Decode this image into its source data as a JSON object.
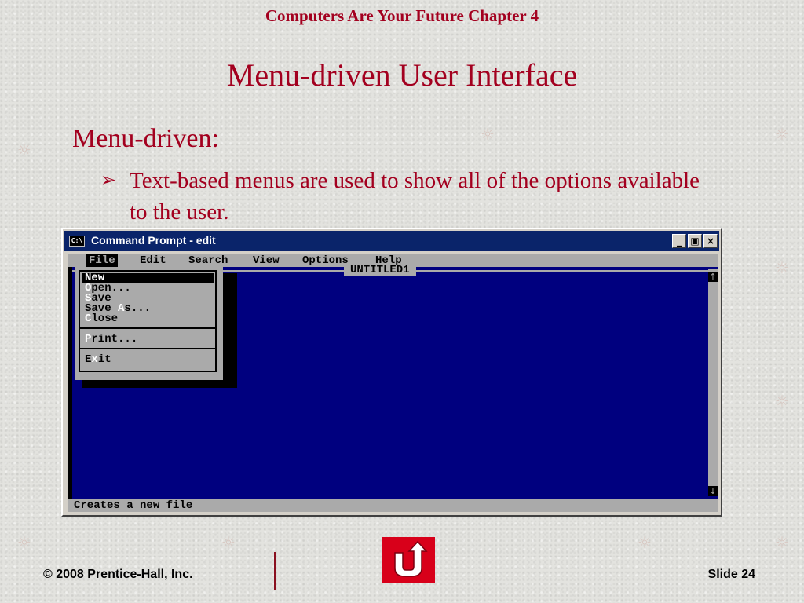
{
  "header": {
    "text": "Computers Are Your Future  Chapter 4"
  },
  "slide": {
    "title": "Menu-driven User Interface",
    "bullet_level1": "Menu-driven:",
    "bullet_level2": "Text-based menus are used to show all of the options available to the user."
  },
  "window": {
    "title": "Command Prompt - edit",
    "icon_label": "C:\\",
    "controls": {
      "minimize": "_",
      "restore": "▣",
      "close": "×"
    }
  },
  "menubar": {
    "items": [
      "File",
      "Edit",
      "Search",
      "View",
      "Options",
      "Help"
    ],
    "active": "File"
  },
  "editor": {
    "document_name": "UNTITLED1",
    "scroll_up": "↑",
    "scroll_down": "↓"
  },
  "file_menu": {
    "items": [
      {
        "label": "New",
        "hotkey": "N",
        "selected": true
      },
      {
        "label": "Open...",
        "hotkey": "O"
      },
      {
        "label": "Save",
        "hotkey": "S"
      },
      {
        "label": "Save As...",
        "hotkey": "A"
      },
      {
        "label": "Close",
        "hotkey": "C"
      },
      {
        "label": "Print...",
        "hotkey": "P"
      },
      {
        "label": "Exit",
        "hotkey": "x"
      }
    ]
  },
  "statusbar": {
    "text": "Creates a new file"
  },
  "footer": {
    "copyright": "© 2008 Prentice-Hall, Inc.",
    "slide_number": "Slide 24"
  },
  "colors": {
    "accent": "#a3001f",
    "titlebar": "#0a246a",
    "editor_bg": "#00007f",
    "menu_gray": "#aaaaaa",
    "nav_button": "#d8001a"
  },
  "icons": {
    "nav": "u-turn-arrow-icon",
    "bullet": "arrow-bullet-icon"
  }
}
